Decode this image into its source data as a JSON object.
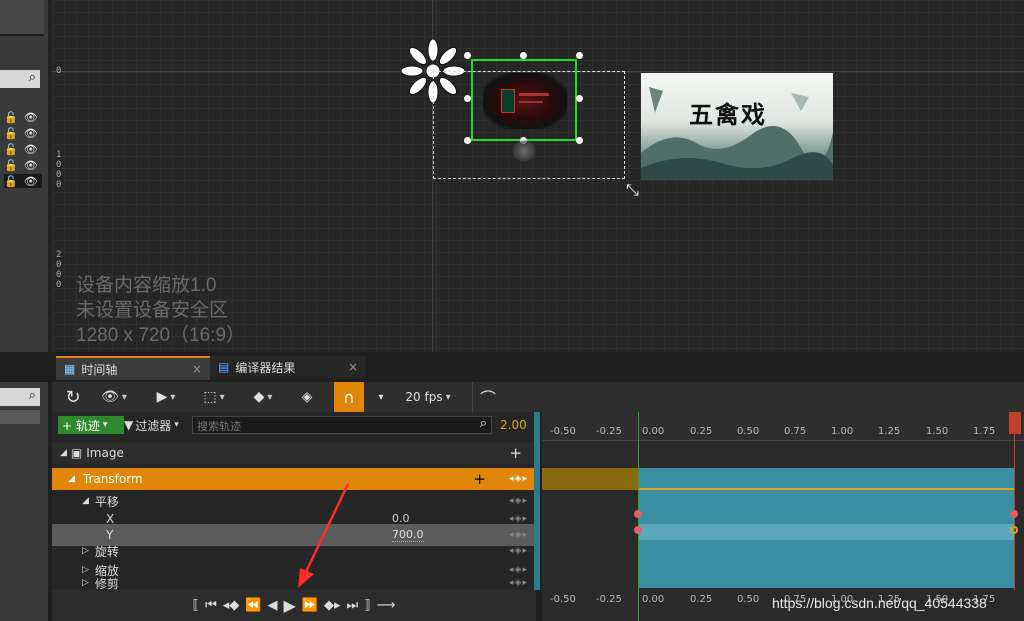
{
  "left_panel": {
    "rows": [
      {
        "lock": "🔓",
        "eye": "👁"
      },
      {
        "lock": "🔓",
        "eye": "👁"
      },
      {
        "lock": "🔓",
        "eye": "👁"
      },
      {
        "lock": "🔓",
        "eye": "👁"
      },
      {
        "lock": "🔓",
        "eye": "👁"
      }
    ]
  },
  "viewport": {
    "ruler_zero": "0",
    "ruler_1000": [
      "1",
      "0",
      "0",
      "0"
    ],
    "ruler_2000": [
      "2",
      "0",
      "0",
      "0"
    ],
    "device_scale": "设备内容缩放1.0",
    "safe_zone": "未设置设备安全区",
    "resolution": "1280 x 720（16:9）",
    "banner_title": "五禽戏"
  },
  "tabs": [
    {
      "label": "时间轴",
      "close": "×"
    },
    {
      "label": "编译器结果",
      "close": "×"
    }
  ],
  "toolbar": {
    "fps": "20 fps",
    "add_track": "+ 轨迹",
    "filter": "过滤器",
    "search_placeholder": "搜索轨迹",
    "duration": "2.00"
  },
  "tracks": {
    "image": "Image",
    "transform": "Transform",
    "translate": "平移",
    "x_label": "X",
    "x_value": "0.0",
    "y_label": "Y",
    "y_value": "700.0",
    "rotate": "旋转",
    "scale": "缩放",
    "shear": "修剪"
  },
  "timeline": {
    "ticks": [
      "-0.50",
      "-0.25",
      "0.00",
      "0.25",
      "0.50",
      "0.75",
      "1.00",
      "1.25",
      "1.50",
      "1.75"
    ],
    "bottom_ticks": [
      "-0.50",
      "-0.25",
      "0.00",
      "0.25",
      "0.50",
      "0.75",
      "1.00",
      "1.25",
      "1.50",
      "1.75"
    ],
    "watermark": "https://blog.csdn.net/qq_40544338"
  },
  "colors": {
    "accent_orange": "#e0860a",
    "track_teal": "#3a8fa3",
    "selection_green": "#22dd22"
  }
}
